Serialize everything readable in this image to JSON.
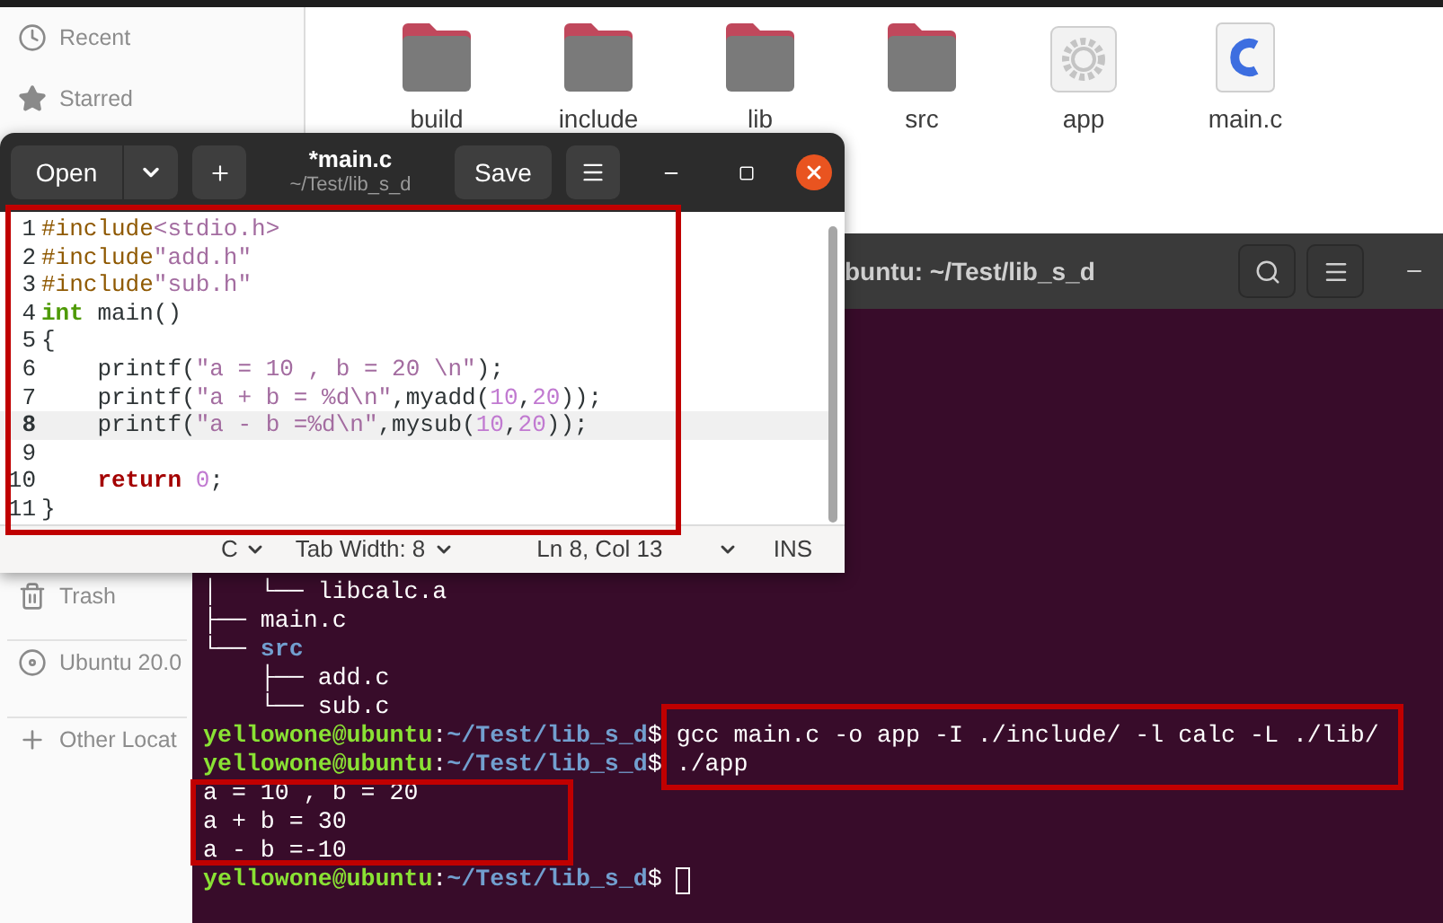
{
  "files_window": {
    "sidebar": [
      {
        "kind": "clock",
        "label": "Recent"
      },
      {
        "kind": "star",
        "label": "Starred"
      },
      {
        "kind": "trash",
        "label": "Trash"
      },
      {
        "kind": "disc",
        "label": "Ubuntu 20.0"
      },
      {
        "kind": "plus",
        "label": "Other Locat"
      }
    ],
    "items": [
      {
        "kind": "folder",
        "label": "build"
      },
      {
        "kind": "folder",
        "label": "include"
      },
      {
        "kind": "folder",
        "label": "lib"
      },
      {
        "kind": "folder",
        "label": "src"
      },
      {
        "kind": "executable",
        "label": "app"
      },
      {
        "kind": "c-source",
        "label": "main.c"
      }
    ]
  },
  "terminal": {
    "title": "buntu: ~/Test/lib_s_d",
    "lines": [
      {
        "segments": [
          {
            "kind": "plain",
            "text": "│   └── libcalc.a"
          }
        ]
      },
      {
        "segments": [
          {
            "kind": "plain",
            "text": "├── main.c"
          }
        ]
      },
      {
        "segments": [
          {
            "kind": "plain",
            "text": "└── "
          },
          {
            "kind": "dir",
            "text": "src"
          }
        ]
      },
      {
        "segments": [
          {
            "kind": "plain",
            "text": "    ├── add.c"
          }
        ]
      },
      {
        "segments": [
          {
            "kind": "plain",
            "text": "    └── sub.c"
          }
        ]
      },
      {
        "segments": [
          {
            "kind": "user",
            "text": "yellowone@ubuntu"
          },
          {
            "kind": "plain",
            "text": ":"
          },
          {
            "kind": "path",
            "text": "~/Test/lib_s_d"
          },
          {
            "kind": "plain",
            "text": "$ gcc main.c -o app -I ./include/ -l calc -L ./lib/"
          }
        ]
      },
      {
        "segments": [
          {
            "kind": "user",
            "text": "yellowone@ubuntu"
          },
          {
            "kind": "plain",
            "text": ":"
          },
          {
            "kind": "path",
            "text": "~/Test/lib_s_d"
          },
          {
            "kind": "plain",
            "text": "$ ./app"
          }
        ]
      },
      {
        "segments": [
          {
            "kind": "plain",
            "text": "a = 10 , b = 20"
          }
        ]
      },
      {
        "segments": [
          {
            "kind": "plain",
            "text": "a + b = 30"
          }
        ]
      },
      {
        "segments": [
          {
            "kind": "plain",
            "text": "a - b =-10"
          }
        ]
      },
      {
        "segments": [
          {
            "kind": "user",
            "text": "yellowone@ubuntu"
          },
          {
            "kind": "plain",
            "text": ":"
          },
          {
            "kind": "path",
            "text": "~/Test/lib_s_d"
          },
          {
            "kind": "plain",
            "text": "$ "
          },
          {
            "kind": "cursor"
          }
        ]
      }
    ]
  },
  "editor": {
    "open_button": "Open",
    "title": "*main.c",
    "subtitle": "~/Test/lib_s_d",
    "save_button": "Save",
    "lines": [
      {
        "number": "1",
        "current": false,
        "tokens": [
          {
            "kind": "preproc",
            "text": "#include"
          },
          {
            "kind": "string",
            "text": "<stdio.h>"
          }
        ]
      },
      {
        "number": "2",
        "current": false,
        "tokens": [
          {
            "kind": "preproc",
            "text": "#include"
          },
          {
            "kind": "string",
            "text": "\"add.h\""
          }
        ]
      },
      {
        "number": "3",
        "current": false,
        "tokens": [
          {
            "kind": "preproc",
            "text": "#include"
          },
          {
            "kind": "string",
            "text": "\"sub.h\""
          }
        ]
      },
      {
        "number": "4",
        "current": false,
        "tokens": [
          {
            "kind": "type",
            "text": "int"
          },
          {
            "kind": "plain",
            "text": " main()"
          }
        ]
      },
      {
        "number": "5",
        "current": false,
        "tokens": [
          {
            "kind": "plain",
            "text": "{"
          }
        ]
      },
      {
        "number": "6",
        "current": false,
        "tokens": [
          {
            "kind": "plain",
            "text": "    printf("
          },
          {
            "kind": "string",
            "text": "\"a = 10 , b = 20 \\n\""
          },
          {
            "kind": "plain",
            "text": ");"
          }
        ]
      },
      {
        "number": "7",
        "current": false,
        "tokens": [
          {
            "kind": "plain",
            "text": "    printf("
          },
          {
            "kind": "string",
            "text": "\"a + b = %d\\n\""
          },
          {
            "kind": "plain",
            "text": ",myadd("
          },
          {
            "kind": "number",
            "text": "10"
          },
          {
            "kind": "plain",
            "text": ","
          },
          {
            "kind": "number",
            "text": "20"
          },
          {
            "kind": "plain",
            "text": "));"
          }
        ]
      },
      {
        "number": "8",
        "current": true,
        "tokens": [
          {
            "kind": "plain",
            "text": "    printf("
          },
          {
            "kind": "string",
            "text": "\"a - b =%d\\n\""
          },
          {
            "kind": "plain",
            "text": ",mysub("
          },
          {
            "kind": "number",
            "text": "10"
          },
          {
            "kind": "plain",
            "text": ","
          },
          {
            "kind": "number",
            "text": "20"
          },
          {
            "kind": "plain",
            "text": "));"
          }
        ]
      },
      {
        "number": "9",
        "current": false
      },
      {
        "number": "10",
        "current": false,
        "tokens": [
          {
            "kind": "keyword",
            "text": "    return"
          },
          {
            "kind": "number",
            "text": " 0"
          },
          {
            "kind": "plain",
            "text": ";"
          }
        ]
      },
      {
        "number": "11",
        "current": false,
        "tokens": [
          {
            "kind": "plain",
            "text": "}"
          }
        ]
      }
    ],
    "status": {
      "language": "C",
      "tab_width": "Tab Width: 8",
      "position": "Ln 8, Col 13",
      "mode": "INS"
    }
  }
}
